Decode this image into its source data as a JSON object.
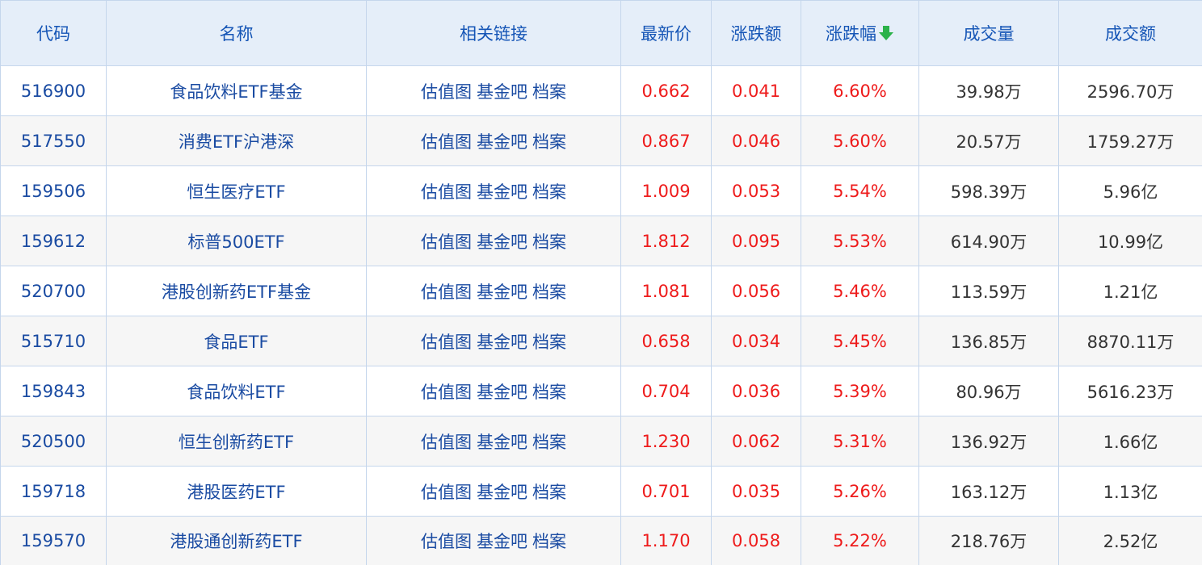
{
  "colors": {
    "up": "#ee1b1b",
    "link": "#1a4ba2",
    "header_text": "#1555b6",
    "sort_arrow": "#2bb24a"
  },
  "headers": {
    "code": "代码",
    "name": "名称",
    "links": "相关链接",
    "price": "最新价",
    "change": "涨跌额",
    "change_pct": "涨跌幅",
    "sort_icon": "arrow-down-icon",
    "volume": "成交量",
    "turnover": "成交额"
  },
  "link_labels": {
    "chart": "估值图",
    "forum": "基金吧",
    "archive": "档案"
  },
  "rows": [
    {
      "code": "516900",
      "name": "食品饮料ETF基金",
      "price": "0.662",
      "change": "0.041",
      "change_pct": "6.60%",
      "volume": "39.98万",
      "turnover": "2596.70万"
    },
    {
      "code": "517550",
      "name": "消费ETF沪港深",
      "price": "0.867",
      "change": "0.046",
      "change_pct": "5.60%",
      "volume": "20.57万",
      "turnover": "1759.27万"
    },
    {
      "code": "159506",
      "name": "恒生医疗ETF",
      "price": "1.009",
      "change": "0.053",
      "change_pct": "5.54%",
      "volume": "598.39万",
      "turnover": "5.96亿"
    },
    {
      "code": "159612",
      "name": "标普500ETF",
      "price": "1.812",
      "change": "0.095",
      "change_pct": "5.53%",
      "volume": "614.90万",
      "turnover": "10.99亿"
    },
    {
      "code": "520700",
      "name": "港股创新药ETF基金",
      "price": "1.081",
      "change": "0.056",
      "change_pct": "5.46%",
      "volume": "113.59万",
      "turnover": "1.21亿"
    },
    {
      "code": "515710",
      "name": "食品ETF",
      "price": "0.658",
      "change": "0.034",
      "change_pct": "5.45%",
      "volume": "136.85万",
      "turnover": "8870.11万"
    },
    {
      "code": "159843",
      "name": "食品饮料ETF",
      "price": "0.704",
      "change": "0.036",
      "change_pct": "5.39%",
      "volume": "80.96万",
      "turnover": "5616.23万"
    },
    {
      "code": "520500",
      "name": "恒生创新药ETF",
      "price": "1.230",
      "change": "0.062",
      "change_pct": "5.31%",
      "volume": "136.92万",
      "turnover": "1.66亿"
    },
    {
      "code": "159718",
      "name": "港股医药ETF",
      "price": "0.701",
      "change": "0.035",
      "change_pct": "5.26%",
      "volume": "163.12万",
      "turnover": "1.13亿"
    },
    {
      "code": "159570",
      "name": "港股通创新药ETF",
      "price": "1.170",
      "change": "0.058",
      "change_pct": "5.22%",
      "volume": "218.76万",
      "turnover": "2.52亿"
    }
  ]
}
